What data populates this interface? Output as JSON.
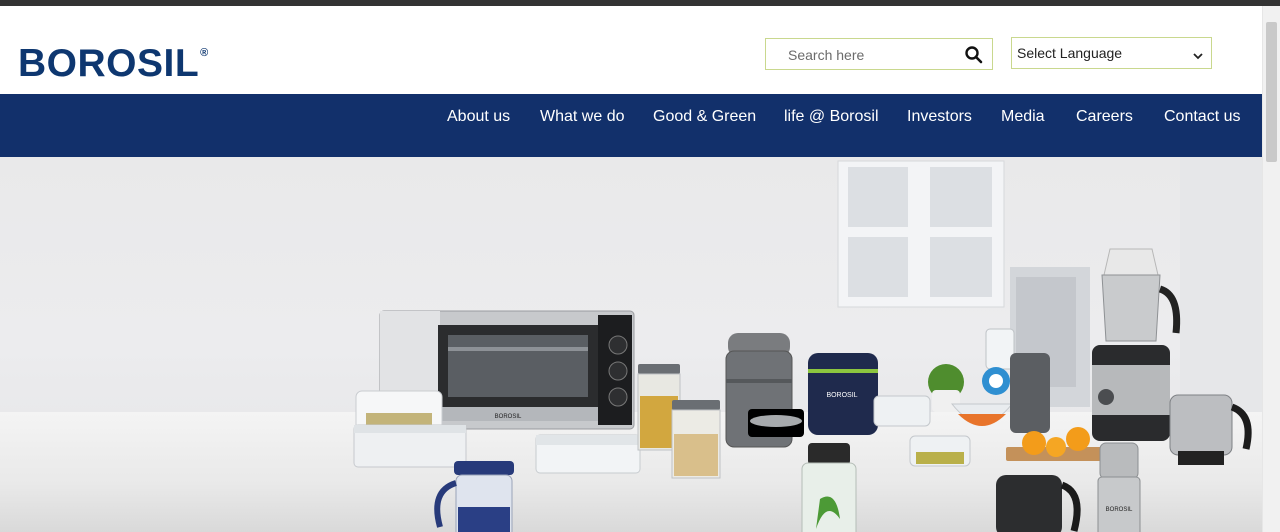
{
  "brand": {
    "name": "BOROSIL",
    "mark": "®"
  },
  "search": {
    "placeholder": "Search here",
    "icon": "search-icon"
  },
  "language": {
    "selected": "Select Language",
    "icon": "chevron-down-icon"
  },
  "nav": {
    "items": [
      {
        "label": "About us"
      },
      {
        "label": "What we do"
      },
      {
        "label": "Good & Green"
      },
      {
        "label": "life @ Borosil"
      },
      {
        "label": "Investors"
      },
      {
        "label": "Media"
      },
      {
        "label": "Careers"
      },
      {
        "label": "Contact us"
      }
    ]
  },
  "hero": {
    "appliance_brand": "BOROSIL"
  },
  "colors": {
    "brand_blue": "#0e3770",
    "nav_bg": "#12306b",
    "field_border": "#c9d88e"
  }
}
